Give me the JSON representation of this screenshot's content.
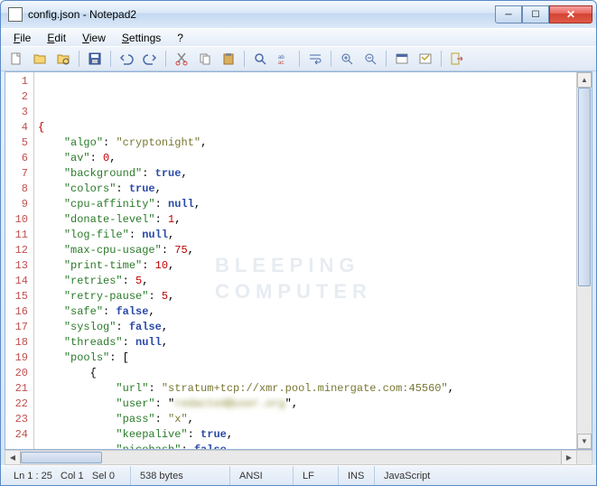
{
  "window": {
    "title": "config.json - Notepad2"
  },
  "menu": {
    "file": "File",
    "edit": "Edit",
    "view": "View",
    "settings": "Settings",
    "help": "?"
  },
  "icons": {
    "new": "new-file-icon",
    "open": "open-folder-icon",
    "browse": "browse-icon",
    "save": "save-icon",
    "undo": "undo-icon",
    "redo": "redo-icon",
    "cut": "cut-icon",
    "copy": "copy-icon",
    "paste": "paste-icon",
    "find": "find-icon",
    "replace": "replace-icon",
    "wordwrap": "wordwrap-icon",
    "zoomin": "zoom-in-icon",
    "zoomout": "zoom-out-icon",
    "scheme": "scheme-icon",
    "customize": "customize-icon",
    "exit": "exit-icon"
  },
  "watermark": {
    "line1": "BLEEPING",
    "line2": "COMPUTER"
  },
  "code": {
    "lines": [
      {
        "n": 1,
        "tokens": [
          {
            "t": "brace",
            "v": "{"
          }
        ]
      },
      {
        "n": 2,
        "tokens": [
          {
            "t": "indent",
            "v": "    "
          },
          {
            "t": "key",
            "v": "\"algo\""
          },
          {
            "t": "punct",
            "v": ": "
          },
          {
            "t": "str",
            "v": "\"cryptonight\""
          },
          {
            "t": "punct",
            "v": ","
          }
        ]
      },
      {
        "n": 3,
        "tokens": [
          {
            "t": "indent",
            "v": "    "
          },
          {
            "t": "key",
            "v": "\"av\""
          },
          {
            "t": "punct",
            "v": ": "
          },
          {
            "t": "num",
            "v": "0"
          },
          {
            "t": "punct",
            "v": ","
          }
        ]
      },
      {
        "n": 4,
        "tokens": [
          {
            "t": "indent",
            "v": "    "
          },
          {
            "t": "key",
            "v": "\"background\""
          },
          {
            "t": "punct",
            "v": ": "
          },
          {
            "t": "bool",
            "v": "true"
          },
          {
            "t": "punct",
            "v": ","
          }
        ]
      },
      {
        "n": 5,
        "tokens": [
          {
            "t": "indent",
            "v": "    "
          },
          {
            "t": "key",
            "v": "\"colors\""
          },
          {
            "t": "punct",
            "v": ": "
          },
          {
            "t": "bool",
            "v": "true"
          },
          {
            "t": "punct",
            "v": ","
          }
        ]
      },
      {
        "n": 6,
        "tokens": [
          {
            "t": "indent",
            "v": "    "
          },
          {
            "t": "key",
            "v": "\"cpu-affinity\""
          },
          {
            "t": "punct",
            "v": ": "
          },
          {
            "t": "bool",
            "v": "null"
          },
          {
            "t": "punct",
            "v": ","
          }
        ]
      },
      {
        "n": 7,
        "tokens": [
          {
            "t": "indent",
            "v": "    "
          },
          {
            "t": "key",
            "v": "\"donate-level\""
          },
          {
            "t": "punct",
            "v": ": "
          },
          {
            "t": "num",
            "v": "1"
          },
          {
            "t": "punct",
            "v": ","
          }
        ]
      },
      {
        "n": 8,
        "tokens": [
          {
            "t": "indent",
            "v": "    "
          },
          {
            "t": "key",
            "v": "\"log-file\""
          },
          {
            "t": "punct",
            "v": ": "
          },
          {
            "t": "bool",
            "v": "null"
          },
          {
            "t": "punct",
            "v": ","
          }
        ]
      },
      {
        "n": 9,
        "tokens": [
          {
            "t": "indent",
            "v": "    "
          },
          {
            "t": "key",
            "v": "\"max-cpu-usage\""
          },
          {
            "t": "punct",
            "v": ": "
          },
          {
            "t": "num",
            "v": "75"
          },
          {
            "t": "punct",
            "v": ","
          }
        ]
      },
      {
        "n": 10,
        "tokens": [
          {
            "t": "indent",
            "v": "    "
          },
          {
            "t": "key",
            "v": "\"print-time\""
          },
          {
            "t": "punct",
            "v": ": "
          },
          {
            "t": "num",
            "v": "10"
          },
          {
            "t": "punct",
            "v": ","
          }
        ]
      },
      {
        "n": 11,
        "tokens": [
          {
            "t": "indent",
            "v": "    "
          },
          {
            "t": "key",
            "v": "\"retries\""
          },
          {
            "t": "punct",
            "v": ": "
          },
          {
            "t": "num",
            "v": "5"
          },
          {
            "t": "punct",
            "v": ","
          }
        ]
      },
      {
        "n": 12,
        "tokens": [
          {
            "t": "indent",
            "v": "    "
          },
          {
            "t": "key",
            "v": "\"retry-pause\""
          },
          {
            "t": "punct",
            "v": ": "
          },
          {
            "t": "num",
            "v": "5"
          },
          {
            "t": "punct",
            "v": ","
          }
        ]
      },
      {
        "n": 13,
        "tokens": [
          {
            "t": "indent",
            "v": "    "
          },
          {
            "t": "key",
            "v": "\"safe\""
          },
          {
            "t": "punct",
            "v": ": "
          },
          {
            "t": "bool",
            "v": "false"
          },
          {
            "t": "punct",
            "v": ","
          }
        ]
      },
      {
        "n": 14,
        "tokens": [
          {
            "t": "indent",
            "v": "    "
          },
          {
            "t": "key",
            "v": "\"syslog\""
          },
          {
            "t": "punct",
            "v": ": "
          },
          {
            "t": "bool",
            "v": "false"
          },
          {
            "t": "punct",
            "v": ","
          }
        ]
      },
      {
        "n": 15,
        "tokens": [
          {
            "t": "indent",
            "v": "    "
          },
          {
            "t": "key",
            "v": "\"threads\""
          },
          {
            "t": "punct",
            "v": ": "
          },
          {
            "t": "bool",
            "v": "null"
          },
          {
            "t": "punct",
            "v": ","
          }
        ]
      },
      {
        "n": 16,
        "tokens": [
          {
            "t": "indent",
            "v": "    "
          },
          {
            "t": "key",
            "v": "\"pools\""
          },
          {
            "t": "punct",
            "v": ": ["
          }
        ]
      },
      {
        "n": 17,
        "tokens": [
          {
            "t": "indent",
            "v": "        "
          },
          {
            "t": "punct",
            "v": "{"
          }
        ]
      },
      {
        "n": 18,
        "tokens": [
          {
            "t": "indent",
            "v": "            "
          },
          {
            "t": "key",
            "v": "\"url\""
          },
          {
            "t": "punct",
            "v": ": "
          },
          {
            "t": "str",
            "v": "\"stratum+tcp://xmr.pool.minergate.com:45560\""
          },
          {
            "t": "punct",
            "v": ","
          }
        ]
      },
      {
        "n": 19,
        "tokens": [
          {
            "t": "indent",
            "v": "            "
          },
          {
            "t": "key",
            "v": "\"user\""
          },
          {
            "t": "punct",
            "v": ": \""
          },
          {
            "t": "blur",
            "v": "redacted@user.org"
          },
          {
            "t": "punct",
            "v": "\","
          }
        ]
      },
      {
        "n": 20,
        "tokens": [
          {
            "t": "indent",
            "v": "            "
          },
          {
            "t": "key",
            "v": "\"pass\""
          },
          {
            "t": "punct",
            "v": ": "
          },
          {
            "t": "str",
            "v": "\"x\""
          },
          {
            "t": "punct",
            "v": ","
          }
        ]
      },
      {
        "n": 21,
        "tokens": [
          {
            "t": "indent",
            "v": "            "
          },
          {
            "t": "key",
            "v": "\"keepalive\""
          },
          {
            "t": "punct",
            "v": ": "
          },
          {
            "t": "bool",
            "v": "true"
          },
          {
            "t": "punct",
            "v": ","
          }
        ]
      },
      {
        "n": 22,
        "tokens": [
          {
            "t": "indent",
            "v": "            "
          },
          {
            "t": "key",
            "v": "\"nicehash\""
          },
          {
            "t": "punct",
            "v": ": "
          },
          {
            "t": "bool",
            "v": "false"
          }
        ]
      },
      {
        "n": 23,
        "tokens": [
          {
            "t": "indent",
            "v": "        "
          },
          {
            "t": "punct",
            "v": "}"
          }
        ]
      },
      {
        "n": 24,
        "tokens": [
          {
            "t": "indent",
            "v": "    "
          },
          {
            "t": "punct",
            "v": "]"
          }
        ]
      }
    ]
  },
  "status": {
    "pos": "Ln 1 : 25",
    "col": "Col 1",
    "sel": "Sel 0",
    "size": "538 bytes",
    "enc": "ANSI",
    "eol": "LF",
    "ovr": "INS",
    "lang": "JavaScript"
  }
}
